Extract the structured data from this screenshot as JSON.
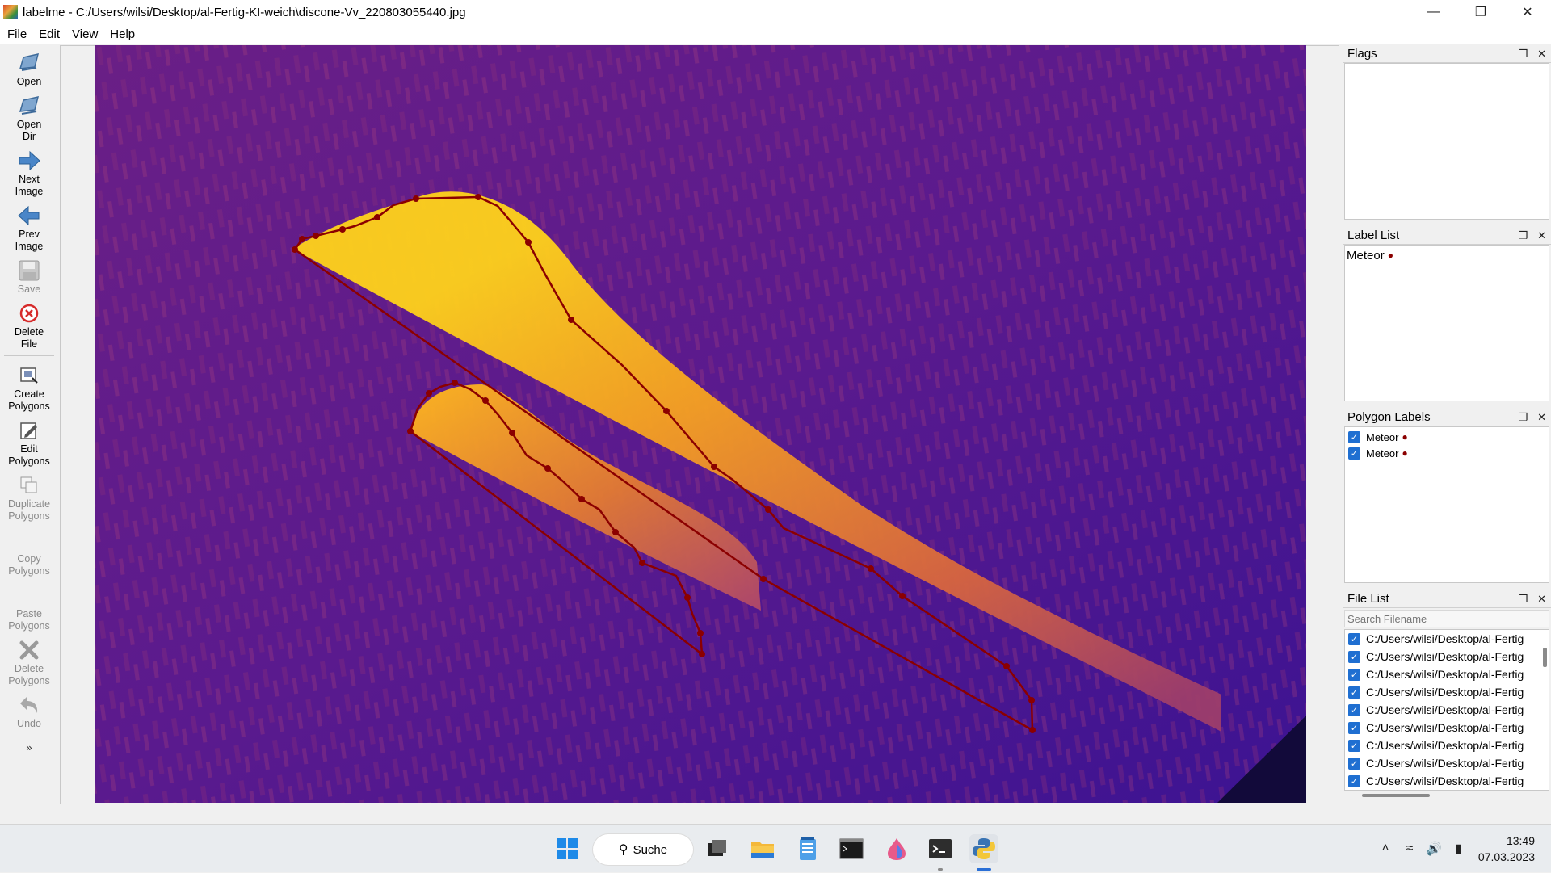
{
  "window": {
    "title": "labelme - C:/Users/wilsi/Desktop/al-Fertig-KI-weich\\discone-Vv_220803055440.jpg"
  },
  "menu": [
    "File",
    "Edit",
    "View",
    "Help"
  ],
  "toolbar": {
    "open": "Open",
    "open_dir": "Open\nDir",
    "next_image": "Next\nImage",
    "prev_image": "Prev\nImage",
    "save": "Save",
    "delete_file": "Delete\nFile",
    "create_polygons": "Create\nPolygons",
    "edit_polygons": "Edit\nPolygons",
    "duplicate_polygons": "Duplicate\nPolygons",
    "copy_polygons": "Copy\nPolygons",
    "paste_polygons": "Paste\nPolygons",
    "delete_polygons": "Delete\nPolygons",
    "undo": "Undo",
    "more": "»"
  },
  "flags": {
    "title": "Flags"
  },
  "label_list": {
    "title": "Label List",
    "items": [
      "Meteor"
    ]
  },
  "polygon_labels": {
    "title": "Polygon Labels",
    "items": [
      "Meteor",
      "Meteor"
    ]
  },
  "file_list": {
    "title": "File List",
    "search_placeholder": "Search Filename",
    "items": [
      "C:/Users/wilsi/Desktop/al-Fertig",
      "C:/Users/wilsi/Desktop/al-Fertig",
      "C:/Users/wilsi/Desktop/al-Fertig",
      "C:/Users/wilsi/Desktop/al-Fertig",
      "C:/Users/wilsi/Desktop/al-Fertig",
      "C:/Users/wilsi/Desktop/al-Fertig",
      "C:/Users/wilsi/Desktop/al-Fertig",
      "C:/Users/wilsi/Desktop/al-Fertig",
      "C:/Users/wilsi/Desktop/al-Fertig"
    ]
  },
  "taskbar": {
    "search_label": "Suche",
    "time": "13:49",
    "date": "07.03.2023"
  },
  "colors": {
    "polygon_line": "#8b0000",
    "label_dot": "#8b0000",
    "checkbox": "#1f6fd1"
  }
}
